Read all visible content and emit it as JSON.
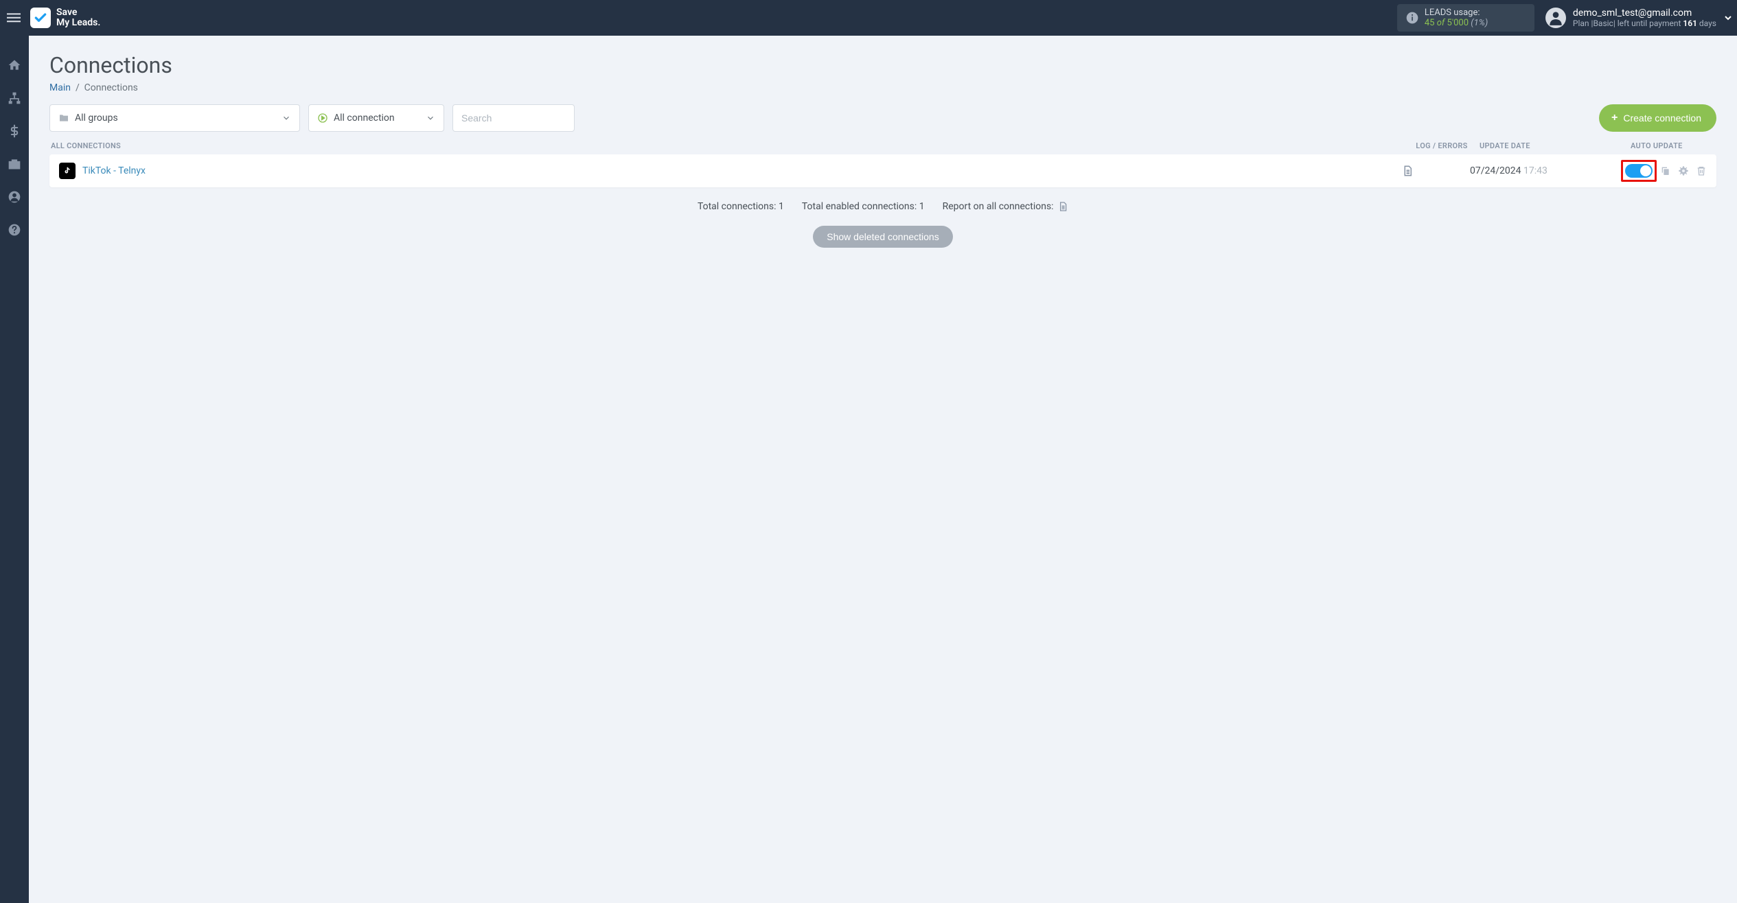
{
  "brand": {
    "line1": "Save",
    "line2": "My Leads."
  },
  "usage": {
    "label": "LEADS usage:",
    "used": "45",
    "of": "of",
    "limit": "5'000",
    "pct": "(1%)"
  },
  "account": {
    "email": "demo_sml_test@gmail.com",
    "plan_prefix": "Plan |",
    "plan_name": "Basic",
    "plan_mid": "| left until payment ",
    "days": "161",
    "plan_suffix": " days"
  },
  "page": {
    "title": "Connections",
    "breadcrumb_main": "Main",
    "breadcrumb_sep": "/",
    "breadcrumb_current": "Connections"
  },
  "filters": {
    "groups_label": "All groups",
    "status_label": "All connection",
    "search_placeholder": "Search"
  },
  "create_label": "Create connection",
  "headers": {
    "name": "ALL CONNECTIONS",
    "log": "LOG / ERRORS",
    "date": "UPDATE DATE",
    "auto": "AUTO UPDATE"
  },
  "rows": [
    {
      "name": "TikTok - Telnyx",
      "date": "07/24/2024",
      "time": "17:43",
      "auto": true
    }
  ],
  "stats": {
    "total": "Total connections: 1",
    "enabled": "Total enabled connections: 1",
    "report": "Report on all connections:"
  },
  "show_deleted": "Show deleted connections"
}
